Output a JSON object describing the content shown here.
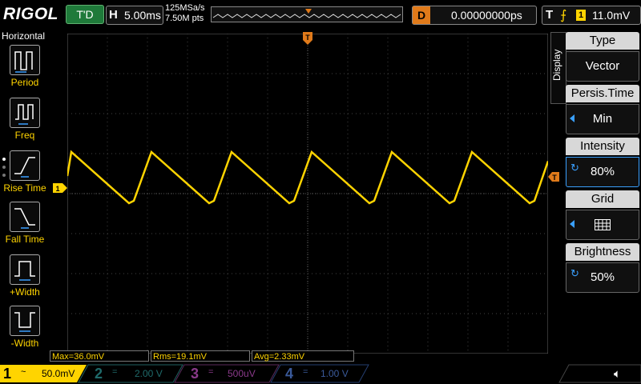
{
  "topbar": {
    "brand": "RIGOL",
    "run_status": "T'D",
    "horizontal_label": "H",
    "timebase": "5.00ms",
    "sample_rate": "125MSa/s",
    "memory_depth": "7.50M pts",
    "delay_label": "D",
    "delay_value": "0.00000000ps",
    "trigger_label": "T",
    "trigger_source": "1",
    "trigger_level": "11.0mV"
  },
  "left_menu": {
    "title": "Horizontal",
    "items": [
      {
        "label": "Period",
        "icon": "period-icon"
      },
      {
        "label": "Freq",
        "icon": "freq-icon"
      },
      {
        "label": "Rise Time",
        "icon": "rise-time-icon"
      },
      {
        "label": "Fall Time",
        "icon": "fall-time-icon"
      },
      {
        "label": "+Width",
        "icon": "pos-width-icon"
      },
      {
        "label": "-Width",
        "icon": "neg-width-icon"
      }
    ]
  },
  "right_menu": {
    "tab": "Display",
    "items": [
      {
        "label": "Type",
        "value": "Vector"
      },
      {
        "label": "Persis.Time",
        "value": "Min"
      },
      {
        "label": "Intensity",
        "value": "80%"
      },
      {
        "label": "Grid",
        "value": ""
      },
      {
        "label": "Brightness",
        "value": "50%"
      }
    ]
  },
  "markers": {
    "trigger_pos": "T",
    "ch1_marker": "1"
  },
  "measurements": {
    "max": "Max=36.0mV",
    "rms": "Rms=19.1mV",
    "avg": "Avg=2.33mV"
  },
  "channels": [
    {
      "num": "1",
      "coupling": "~",
      "scale": "50.0mV",
      "color": "#ffd400"
    },
    {
      "num": "2",
      "coupling": "=",
      "scale": "2.00 V",
      "color": "#22c2c2"
    },
    {
      "num": "3",
      "coupling": "=",
      "scale": "500uV",
      "color": "#d13fd1"
    },
    {
      "num": "4",
      "coupling": "=",
      "scale": "1.00 V",
      "color": "#2a6ad8"
    }
  ],
  "colors": {
    "ch1": "#ffd400",
    "trigger": "#e07a1a",
    "grid": "#5a5a5a"
  },
  "waveform": {
    "shape": "sawtooth",
    "cycles_visible": 6
  }
}
